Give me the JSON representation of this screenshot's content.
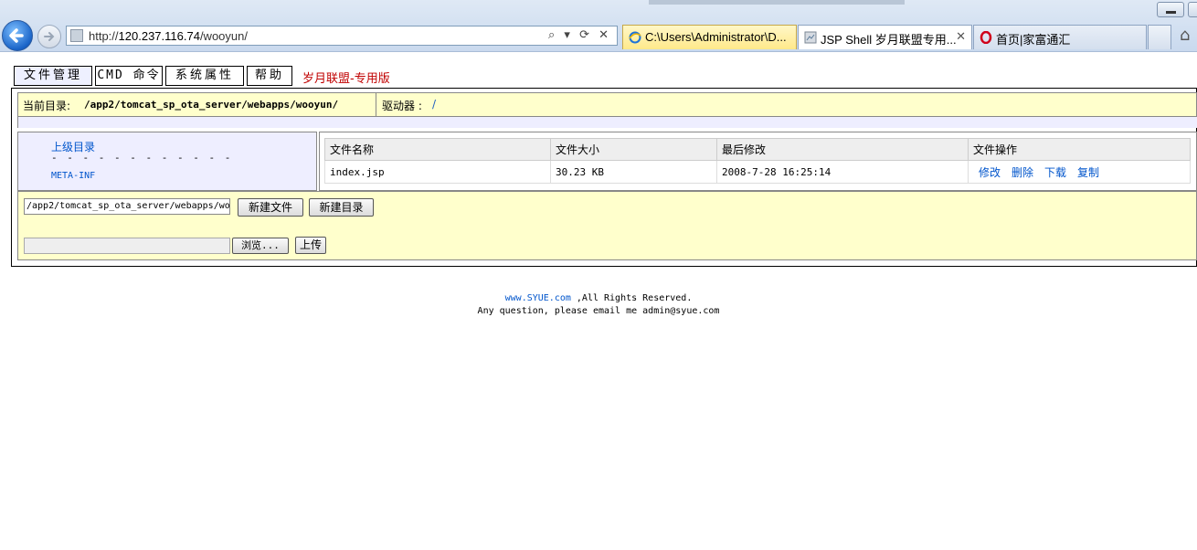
{
  "browser": {
    "url_prefix": "http://",
    "url_host": "120.237.116.74",
    "url_path": "/wooyun/",
    "tabs": [
      {
        "label": "C:\\Users\\Administrator\\D...",
        "icon": "ie-icon"
      },
      {
        "label": "JSP Shell 岁月联盟专用...",
        "icon": "page-icon",
        "close": "✕"
      },
      {
        "label": "首页|家富通汇",
        "icon": "opera-icon"
      }
    ],
    "tools": "⌕ ▾ ⟳ ✕"
  },
  "menu": {
    "file_manage": "文件管理",
    "cmd": "CMD 命令",
    "sys_props": "系统属性",
    "help": "帮助",
    "brand": "岁月联盟-专用版"
  },
  "dir": {
    "current_label": "当前目录:",
    "current_path": "/app2/tomcat_sp_ota_server/webapps/wooyun/",
    "drive_label": "驱动器 :",
    "drive_value": "/"
  },
  "tree": {
    "parent": "上级目录",
    "dashes": "- - - - - - - - - - - -",
    "items": [
      "META-INF"
    ]
  },
  "table": {
    "headers": [
      "文件名称",
      "文件大小",
      "最后修改",
      "文件操作"
    ],
    "rows": [
      {
        "name": "index.jsp",
        "size": "30.23 KB",
        "modified": "2008-7-28 16:25:14",
        "actions": [
          "修改",
          "删除",
          "下载",
          "复制"
        ]
      }
    ]
  },
  "form": {
    "path_value": "/app2/tomcat_sp_ota_server/webapps/wo",
    "new_file": "新建文件",
    "new_dir": "新建目录",
    "browse": "浏览...",
    "upload": "上传"
  },
  "footer": {
    "site": "www.SYUE.com",
    "rights": " ,All Rights Reserved.",
    "contact": "Any question, please email me admin@syue.com"
  }
}
